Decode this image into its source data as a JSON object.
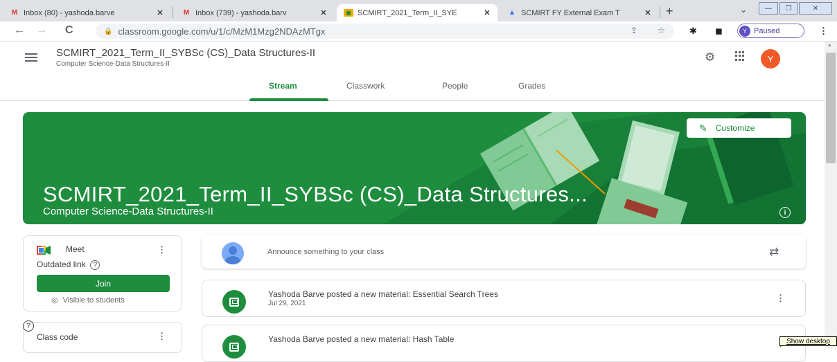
{
  "browser": {
    "tabs": [
      {
        "title": "Inbox (80) - yashoda.barve",
        "icon": "gmail-icon",
        "active": false
      },
      {
        "title": "Inbox (739) - yashoda.barv",
        "icon": "gmail-icon",
        "active": false
      },
      {
        "title": "SCMIRT_2021_Term_II_SYE",
        "icon": "classroom-icon",
        "active": true
      },
      {
        "title": "SCMIRT FY External Exam T",
        "icon": "drive-icon",
        "active": false
      }
    ],
    "url": "classroom.google.com/u/1/c/MzM1Mzg2NDAzMTgx",
    "profile_label": "Paused",
    "profile_initial": "Y"
  },
  "classroom": {
    "class_title": "SCMIRT_2021_Term_II_SYBSc (CS)_Data Structures-II",
    "class_subtitle": "Computer Science-Data Structures-II",
    "avatar_initial": "Y",
    "nav_tabs": [
      {
        "label": "Stream",
        "active": true
      },
      {
        "label": "Classwork",
        "active": false
      },
      {
        "label": "People",
        "active": false
      },
      {
        "label": "Grades",
        "active": false
      }
    ],
    "banner": {
      "title": "SCMIRT_2021_Term_II_SYBSc (CS)_Data Structures...",
      "subtitle": "Computer Science-Data Structures-II",
      "customize_label": "Customize",
      "color": "#1e8e3e"
    },
    "meet": {
      "title": "Meet",
      "status": "Outdated link",
      "join_label": "Join",
      "visibility": "Visible to students"
    },
    "class_code": {
      "label": "Class code"
    },
    "announce_placeholder": "Announce something to your class",
    "posts": [
      {
        "title": "Yashoda Barve posted a new material: Essential Search Trees",
        "date": "Jul 29, 2021"
      },
      {
        "title": "Yashoda Barve posted a new material: Hash Table",
        "date": ""
      }
    ]
  },
  "os": {
    "show_desktop": "Show desktop"
  }
}
